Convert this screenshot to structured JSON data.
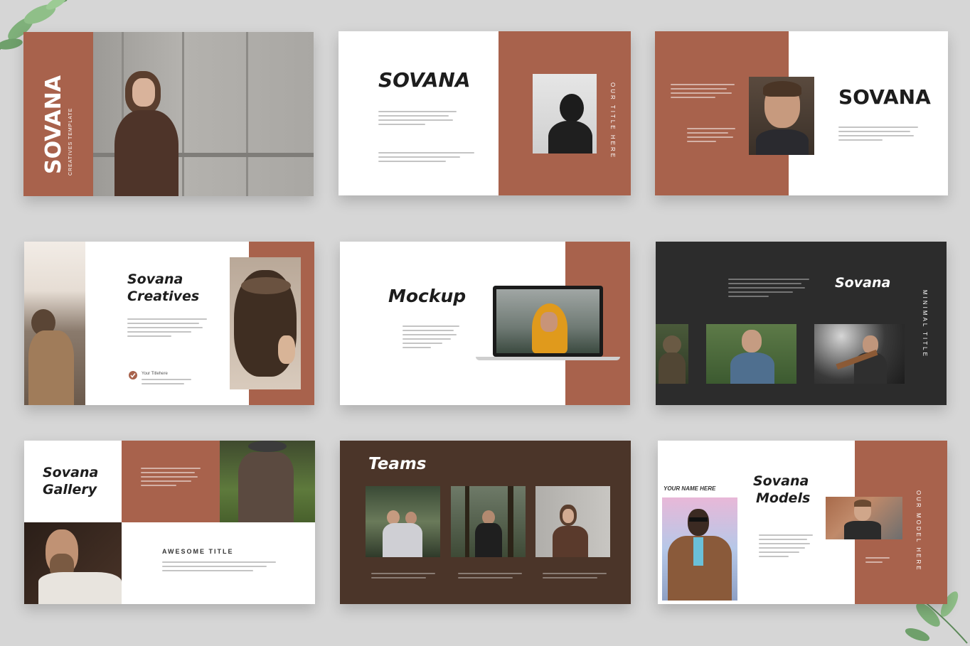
{
  "colors": {
    "background": "#d6d6d6",
    "terracotta": "#a8624c",
    "charcoal": "#2c2c2c",
    "brown": "#4b3529",
    "white": "#ffffff"
  },
  "slides": {
    "cover": {
      "title": "SOVANA",
      "subtitle": "CREATIVES TEMPLATE"
    },
    "slide2": {
      "title": "SOVANA",
      "side_label": "OUR TITLE HERE"
    },
    "slide3": {
      "title": "SOVANA"
    },
    "slide4": {
      "title_line1": "Sovana",
      "title_line2": "Creatives",
      "check_label": "Your Titlehere"
    },
    "slide5": {
      "title": "Mockup"
    },
    "slide6": {
      "title": "Sovana",
      "side_label": "MINIMAL TITLE"
    },
    "slide7": {
      "title_line1": "Sovana",
      "title_line2": "Gallery",
      "subheading": "AWESOME TITLE"
    },
    "slide8": {
      "title": "Teams"
    },
    "slide9": {
      "name_label": "YOUR NAME HERE",
      "title_line1": "Sovana",
      "title_line2": "Models",
      "side_label": "OUR MODEL HERE"
    }
  },
  "icons": [
    "leaf-icon",
    "check-icon",
    "laptop-icon"
  ]
}
